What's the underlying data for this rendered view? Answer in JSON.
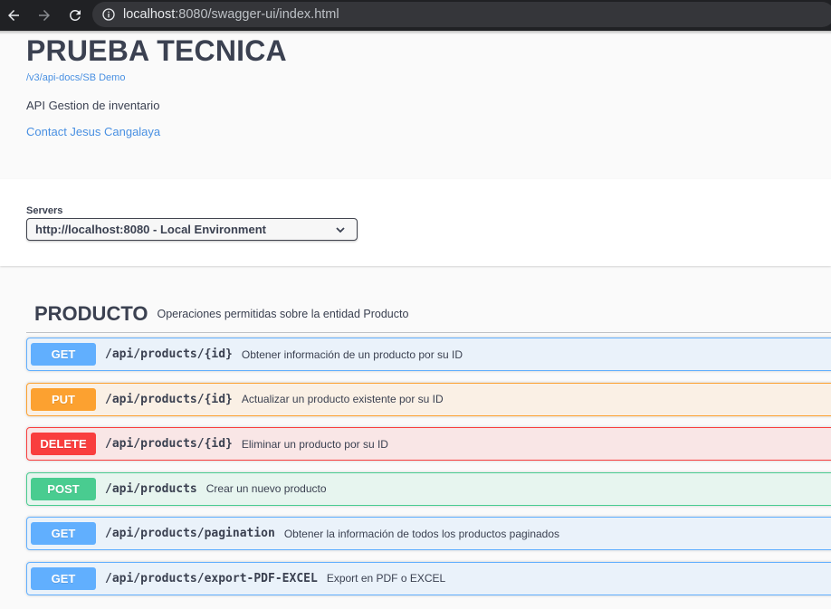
{
  "browser": {
    "url_host": "localhost",
    "url_rest": ":8080/swagger-ui/index.html"
  },
  "info": {
    "title": "PRUEBA TECNICA",
    "api_docs_link": "/v3/api-docs/SB Demo",
    "description": "API Gestion de inventario",
    "contact": "Contact Jesus Cangalaya"
  },
  "servers": {
    "label": "Servers",
    "selected": "http://localhost:8080 - Local Environment"
  },
  "tag": {
    "name": "PRODUCTO",
    "description": "Operaciones permitidas sobre la entidad Producto"
  },
  "operations": [
    {
      "method": "GET",
      "path": "/api/products/{id}",
      "summary": "Obtener información de un producto por su ID"
    },
    {
      "method": "PUT",
      "path": "/api/products/{id}",
      "summary": "Actualizar un producto existente por su ID"
    },
    {
      "method": "DELETE",
      "path": "/api/products/{id}",
      "summary": "Eliminar un producto por su ID"
    },
    {
      "method": "POST",
      "path": "/api/products",
      "summary": "Crear un nuevo producto"
    },
    {
      "method": "GET",
      "path": "/api/products/pagination",
      "summary": "Obtener la información de todos los productos paginados"
    },
    {
      "method": "GET",
      "path": "/api/products/export-PDF-EXCEL",
      "summary": "Export en PDF o EXCEL"
    }
  ],
  "colors": {
    "get": "#61affe",
    "put": "#fca130",
    "delete": "#f93e3e",
    "post": "#49cc90",
    "link": "#4990e2"
  }
}
